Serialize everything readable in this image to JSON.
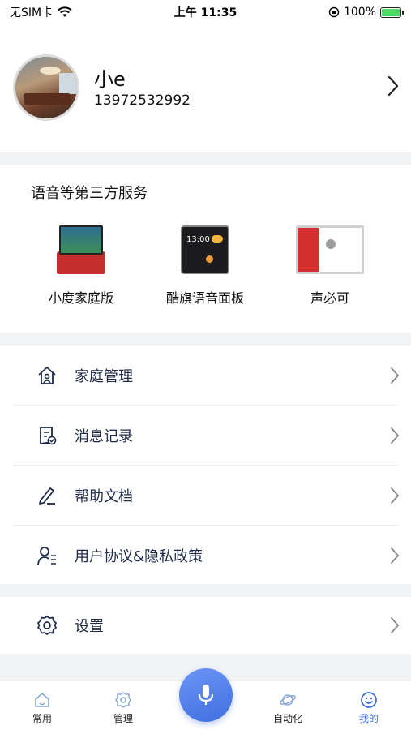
{
  "status_bar": {
    "carrier": "无SIM卡",
    "time": "上午 11:35",
    "battery": "100%"
  },
  "profile": {
    "name": "小e",
    "phone": "13972532992"
  },
  "services": {
    "title": "语音等第三方服务",
    "devices": [
      {
        "label": "小度家庭版"
      },
      {
        "label": "酷旗语音面板",
        "screen_time": "13:00"
      },
      {
        "label": "声必可"
      }
    ]
  },
  "menu": {
    "items": [
      {
        "label": "家庭管理",
        "icon": "home-icon"
      },
      {
        "label": "消息记录",
        "icon": "message-record-icon"
      },
      {
        "label": "帮助文档",
        "icon": "pen-doc-icon"
      },
      {
        "label": "用户协议&隐私政策",
        "icon": "user-agreement-icon"
      }
    ],
    "settings": {
      "label": "设置",
      "icon": "gear-icon"
    }
  },
  "tabbar": {
    "tabs": [
      {
        "label": "常用",
        "icon": "home-icon"
      },
      {
        "label": "管理",
        "icon": "gear-icon"
      },
      {
        "label": "自动化",
        "icon": "planet-icon"
      },
      {
        "label": "我的",
        "icon": "smile-icon",
        "active": true
      }
    ],
    "accent_color": "#3f6fe0"
  }
}
